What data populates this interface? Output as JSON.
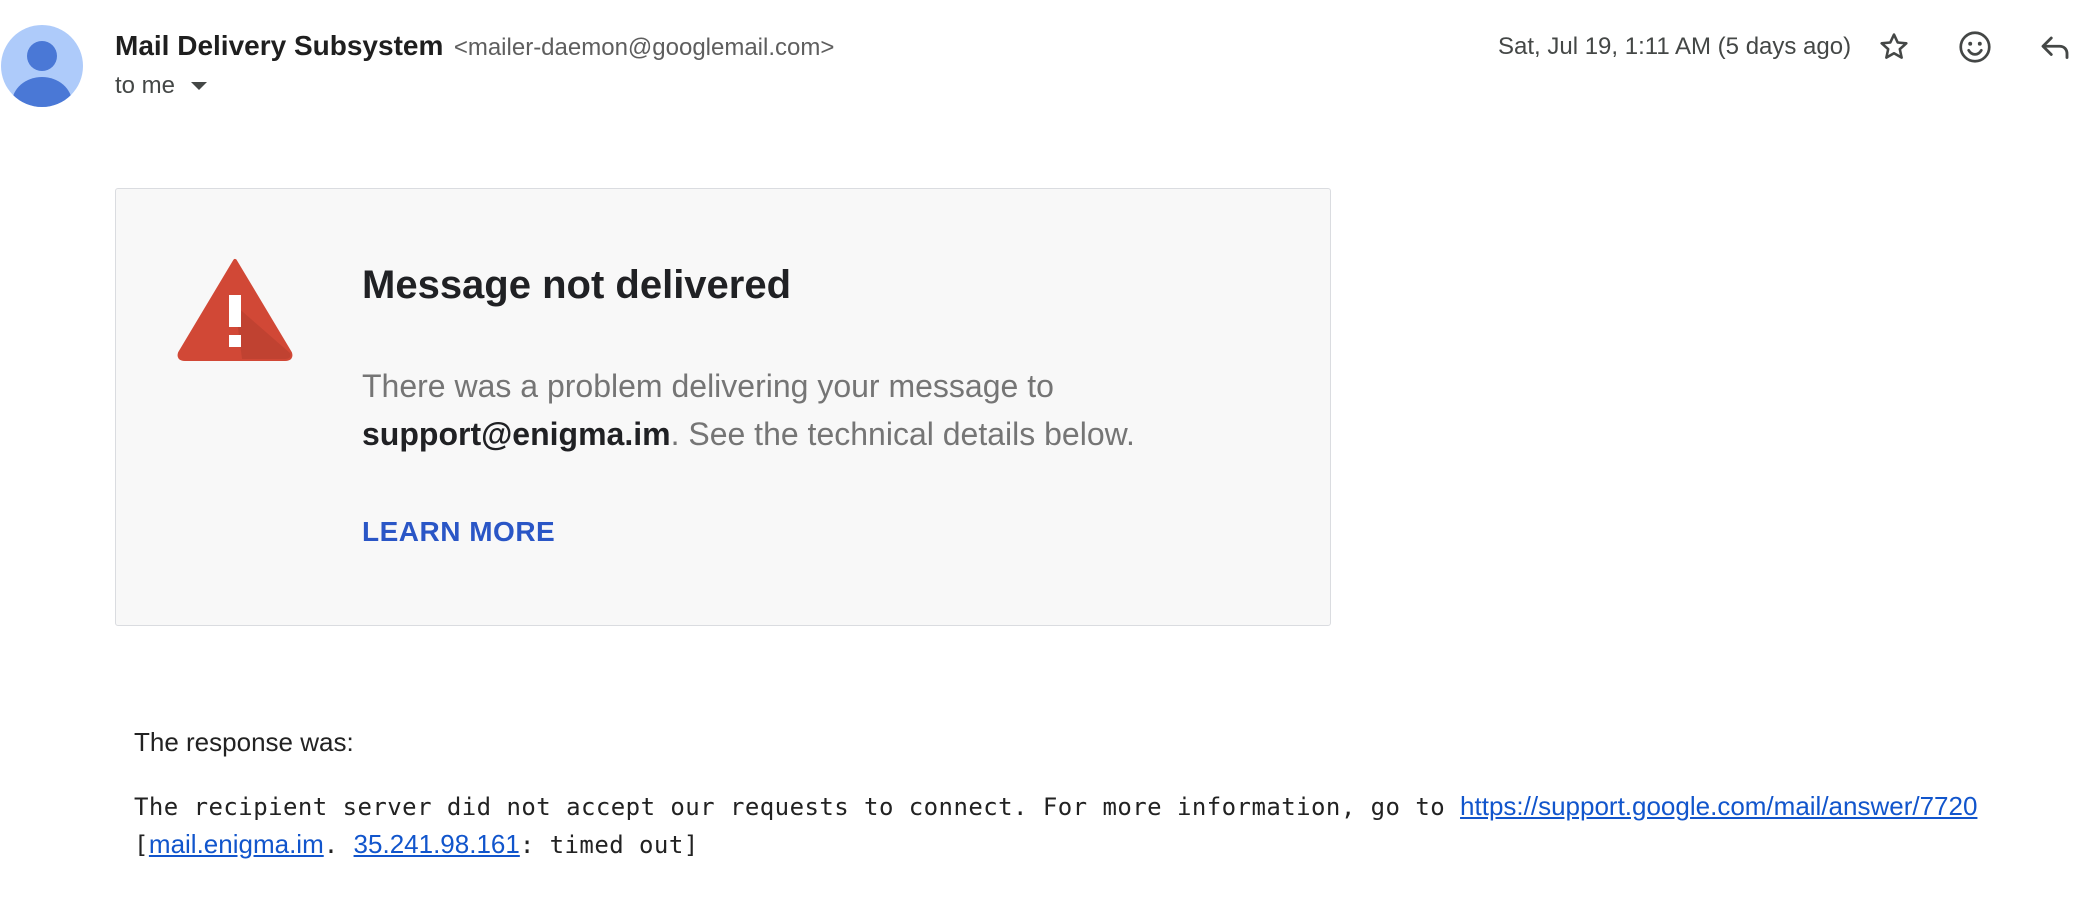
{
  "header": {
    "sender_name": "Mail Delivery Subsystem",
    "sender_email": "<mailer-daemon@googlemail.com>",
    "to_label": "to me",
    "date": "Sat, Jul 19, 1:11 AM (5 days ago)",
    "icons": [
      "star-icon",
      "emoji-icon",
      "reply-icon"
    ]
  },
  "card": {
    "title": "Message not delivered",
    "message_before": "There was a problem delivering your message to",
    "recipient": "support@enigma.im",
    "message_after": ". See the technical details below.",
    "learn_more": "LEARN MORE",
    "accent_color": "#2a56c6",
    "warning_color": "#d14836"
  },
  "details": {
    "response_label": "The response was:",
    "line1_text": "The recipient server did not accept our requests to connect. For more information, go to ",
    "line1_link": "https://support.google.com/mail/answer/7720",
    "line2_open": "[",
    "line2_link1": "mail.enigma.im",
    "line2_sep": ". ",
    "line2_link2": "35.241.98.161",
    "line2_close": ": timed out]"
  }
}
